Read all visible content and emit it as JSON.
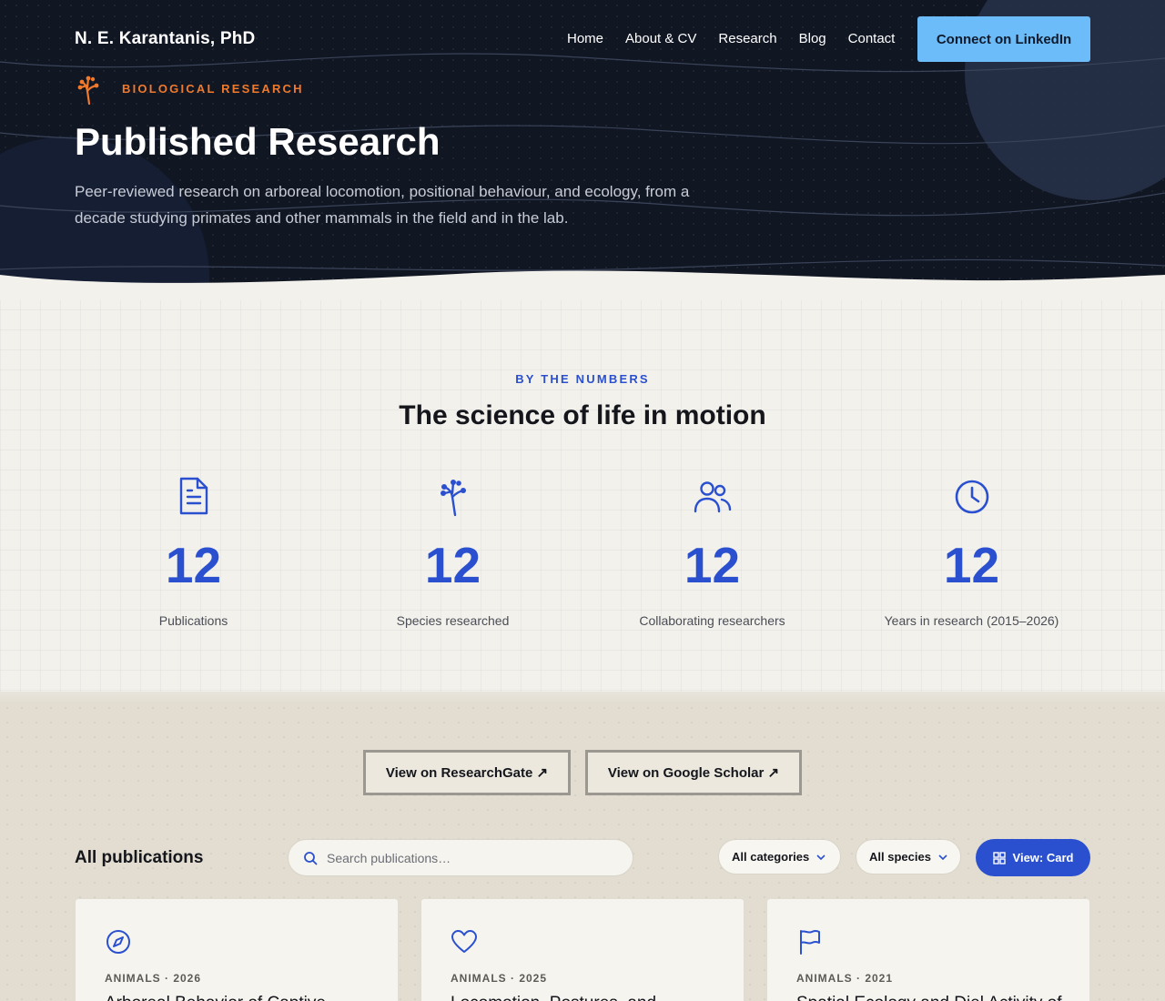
{
  "header": {
    "brand": "N. E. Karantanis, PhD",
    "nav": [
      "Home",
      "About & CV",
      "Research",
      "Blog",
      "Contact"
    ],
    "cta_label": "Connect on LinkedIn"
  },
  "hero": {
    "eyebrow": "BIOLOGICAL RESEARCH",
    "title": "Published Research",
    "subtitle": "Peer-reviewed research on arboreal locomotion, positional behaviour, and ecology, from a decade studying primates and other mammals in the field and in the lab.",
    "eyebrow_icon": "branch-icon"
  },
  "numbers": {
    "eyebrow": "BY THE NUMBERS",
    "title": "The science of life in motion",
    "stats": [
      {
        "value": "12",
        "label": "Publications",
        "icon": "document-icon"
      },
      {
        "value": "12",
        "label": "Species researched",
        "icon": "branch-icon"
      },
      {
        "value": "12",
        "label": "Collaborating researchers",
        "icon": "users-icon"
      },
      {
        "value": "12",
        "label": "Years in research (2015–2026)",
        "icon": "clock-icon"
      }
    ]
  },
  "external_links": {
    "researchgate": "View on ResearchGate ↗",
    "scholar": "View on Google Scholar ↗"
  },
  "publications": {
    "heading": "All publications",
    "search_placeholder": "Search publications…",
    "category_filter": "All categories",
    "species_filter": "All species",
    "view_toggle": "View: Card",
    "cards": [
      {
        "meta": "ANIMALS · 2026",
        "title": "Arboreal Behavior of Captive",
        "icon": "compass-icon"
      },
      {
        "meta": "ANIMALS · 2025",
        "title": "Locomotion, Postures, and",
        "icon": "heart-icon"
      },
      {
        "meta": "ANIMALS · 2021",
        "title": "Spatial Ecology and Diel Activity of",
        "icon": "flag-icon"
      }
    ]
  },
  "colors": {
    "hero_bg": "#111623",
    "accent_blue": "#2a50cf",
    "accent_orange": "#f07a2c",
    "cta_bg": "#6cbcfa",
    "page_bg": "#e2ddd0"
  }
}
